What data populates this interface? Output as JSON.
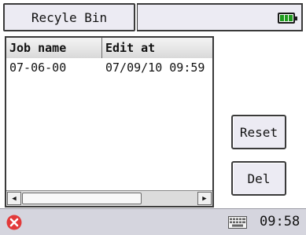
{
  "titlebar": {
    "title": "Recyle Bin",
    "battery_icon": "battery-full-icon",
    "battery_color": "#1e9a1e"
  },
  "listview": {
    "columns": [
      "Job name",
      "Edit at"
    ],
    "rows": [
      [
        "07-06-00",
        "07/09/10 09:59"
      ]
    ]
  },
  "buttons": {
    "reset_label": "Reset",
    "del_label": "Del"
  },
  "bottombar": {
    "close_icon": "close-icon",
    "close_color": "#e23a3a",
    "keyboard_icon": "keyboard-icon",
    "time": "09:58"
  }
}
